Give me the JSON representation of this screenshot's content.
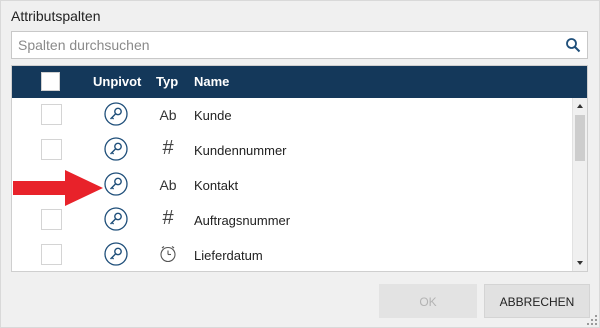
{
  "dialog": {
    "title": "Attributspalten",
    "search": {
      "placeholder": "Spalten durchsuchen",
      "value": ""
    },
    "table": {
      "columns": {
        "unpivot": "Unpivot",
        "typ": "Typ",
        "name": "Name"
      },
      "rows": [
        {
          "type_glyph": "Ab",
          "type_icon": "text-type-icon",
          "name": "Kunde"
        },
        {
          "type_glyph": "#",
          "type_icon": "number-type-icon",
          "name": "Kundennummer"
        },
        {
          "type_glyph": "Ab",
          "type_icon": "text-type-icon",
          "name": "Kontakt"
        },
        {
          "type_glyph": "#",
          "type_icon": "number-type-icon",
          "name": "Auftragsnummer"
        },
        {
          "type_glyph": "",
          "type_icon": "clock-icon",
          "name": "Lieferdatum"
        }
      ]
    },
    "buttons": {
      "ok": "OK",
      "cancel": "ABBRECHEN"
    },
    "colors": {
      "header": "#14385a",
      "key_icon": "#1f4f7a",
      "annotation_arrow": "#e8222a"
    }
  }
}
